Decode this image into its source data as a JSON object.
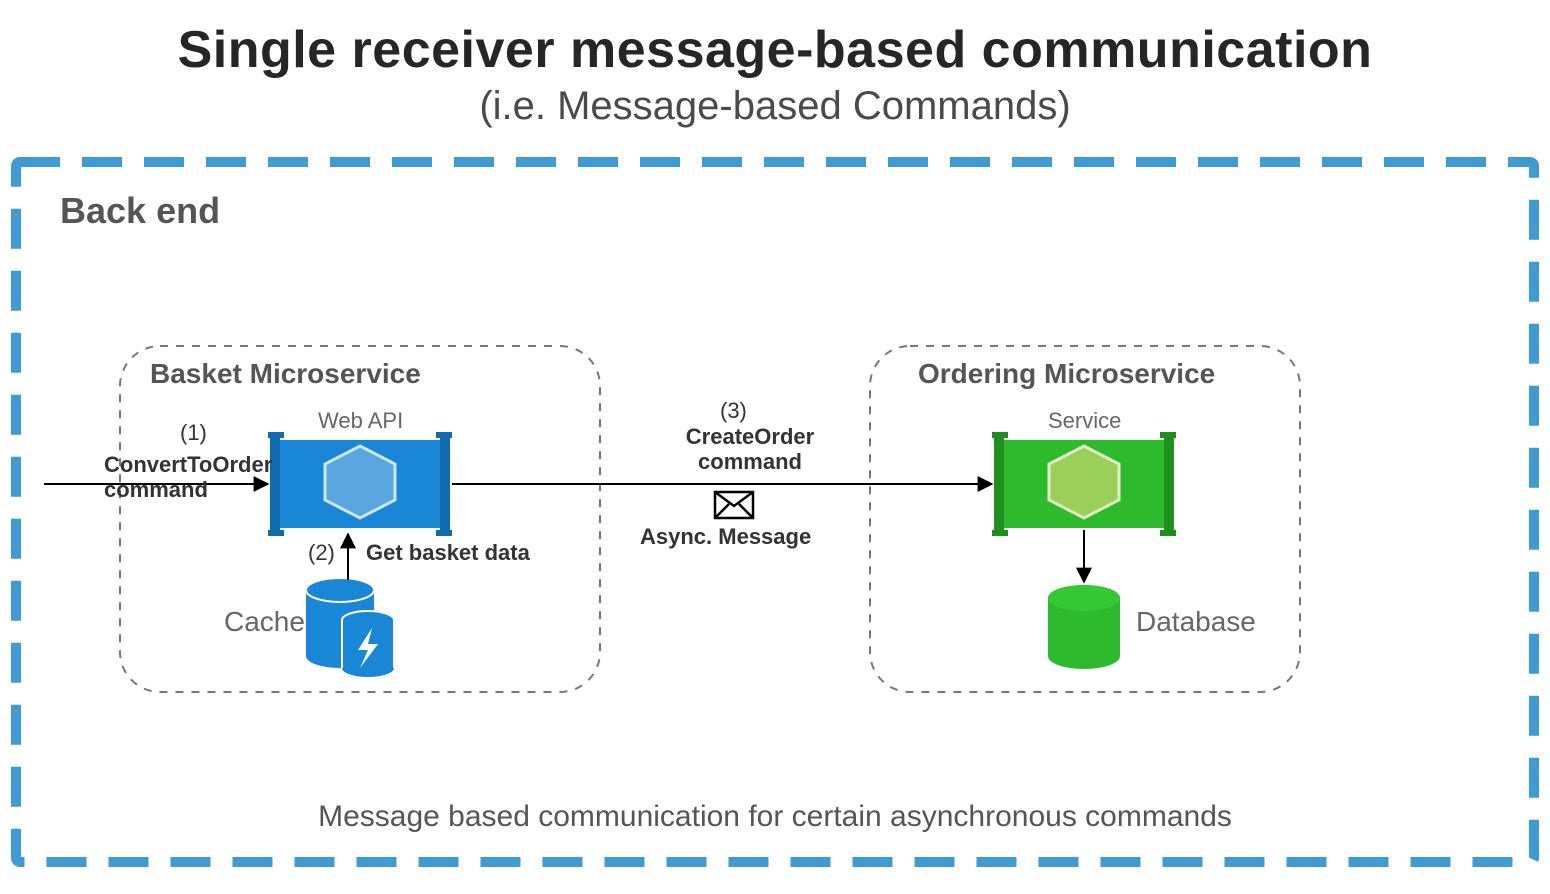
{
  "title": {
    "main": "Single receiver message-based communication",
    "sub": "(i.e. Message-based Commands)"
  },
  "backend_label": "Back end",
  "basket": {
    "title": "Basket Microservice",
    "service_label": "Web API",
    "store_label": "Cache"
  },
  "ordering": {
    "title": "Ordering Microservice",
    "service_label": "Service",
    "store_label": "Database"
  },
  "steps": {
    "s1_num": "(1)",
    "s1_text": "ConvertToOrder\ncommand",
    "s2_num": "(2)",
    "s2_text": "Get basket data",
    "s3_num": "(3)",
    "s3_text": "CreateOrder\ncommand",
    "s3_async": "Async. Message"
  },
  "footer": "Message based communication for certain asynchronous commands",
  "colors": {
    "blue": "#1a86d6",
    "blue_dashed": "#3f9bd1",
    "blue_light": "#4ea0dd",
    "green": "#2dba2d",
    "green_light": "#9bcf5a",
    "grey": "#888"
  }
}
